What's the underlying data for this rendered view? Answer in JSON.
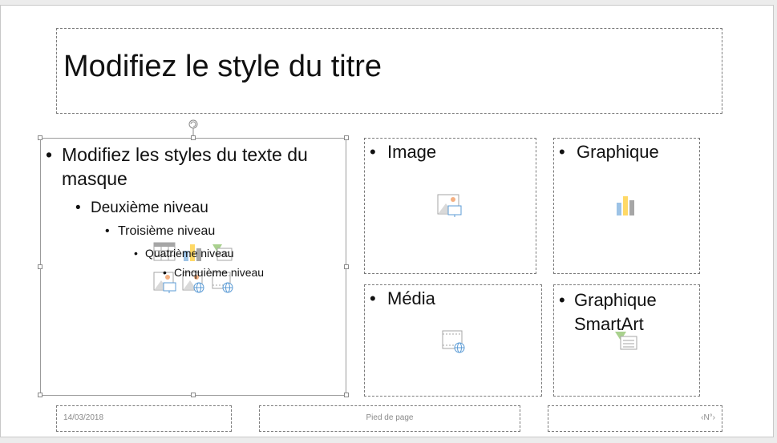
{
  "title": {
    "text": "Modifiez le style du titre"
  },
  "content": {
    "level1": "Modifiez les styles du texte du masque",
    "level1_line1": "Modifiez les styles du texte du",
    "level1_line2": "masque",
    "level2": "Deuxième niveau",
    "level3": "Troisième niveau",
    "level4": "Quatrième niveau",
    "level5": "Cinquième niveau",
    "bullet": "•"
  },
  "placeholders": {
    "image": {
      "label": "Image",
      "icon": "image-icon"
    },
    "graphique": {
      "label": "Graphique",
      "icon": "chart-icon"
    },
    "media": {
      "label": "Média",
      "icon": "video-icon"
    },
    "smartart": {
      "line1": "Graphique",
      "line2": "SmartArt",
      "icon": "smartart-icon"
    }
  },
  "content_insert_icons": [
    "table-icon",
    "chart-icon",
    "smartart-icon",
    "picture-icon",
    "online-picture-icon",
    "video-icon"
  ],
  "footer": {
    "date": "14/03/2018",
    "text": "Pied de page",
    "number": "‹N°›"
  },
  "colors": {
    "accent_orange": "#f4b183",
    "accent_blue": "#9dc3e6",
    "accent_green": "#a9d18e",
    "icon_gray": "#a6a6a6"
  }
}
